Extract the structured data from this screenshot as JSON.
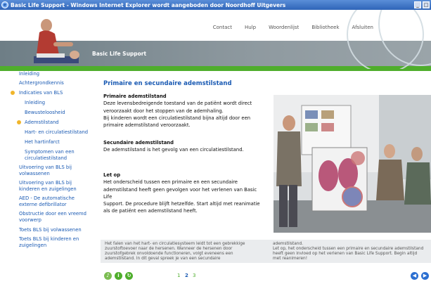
{
  "window": {
    "title": "Basic Life Support - Windows Internet Explorer wordt aangeboden door Noordhoff Uitgevers"
  },
  "topnav": [
    "Contact",
    "Hulp",
    "Woordenlijst",
    "Bibliotheek",
    "Afsluiten"
  ],
  "header": {
    "section_title": "Basic Life Support"
  },
  "sidebar": {
    "items": [
      {
        "label": "Inleiding"
      },
      {
        "label": "Achtergrondkennis"
      },
      {
        "label": "Indicaties van BLS"
      },
      {
        "label": "Inleiding"
      },
      {
        "label": "Bewusteloosheid"
      },
      {
        "label": "Ademstilstand"
      },
      {
        "label": "Hart- en circulatiestilstand"
      },
      {
        "label": "Het hartinfarct"
      },
      {
        "label": "Symptomen van een"
      },
      {
        "label": "circulatiestilstand"
      },
      {
        "label": "Uitvoering van BLS bij"
      },
      {
        "label": "volwassenen"
      },
      {
        "label": "Uitvoering van BLS bij"
      },
      {
        "label": "kinderen en zuigelingen"
      },
      {
        "label": "AED - De automatische"
      },
      {
        "label": "externe defibrillator"
      },
      {
        "label": "Obstructie door een vreemd"
      },
      {
        "label": "voorwerp"
      },
      {
        "label": "Toets BLS bij volwassenen"
      },
      {
        "label": "Toets BLS bij kinderen en"
      },
      {
        "label": "zuigelingen"
      }
    ]
  },
  "main": {
    "title": "Primaire en secundaire ademstilstand",
    "primary_heading": "Primaire ademstilstand",
    "primary_lines": [
      "Deze levensbedreigende toestand van de patiënt wordt direct",
      "veroorzaakt door het stoppen van de ademhaling.",
      "Bij kinderen wordt een circulatiestilstand bijna altijd door een",
      "primaire ademstilstand veroorzaakt."
    ],
    "secondary_heading": "Secundaire ademstilstand",
    "secondary_line": "De ademstilstand is het gevolg van een circulatiestilstand.",
    "note_heading": "Let op",
    "note_lines": [
      "Het onderscheid tussen een primaire en een secundaire",
      "ademstilstand heeft geen gevolgen voor het verlenen van Basic Life",
      "Support. De procedure blijft hetzelfde. Start altijd met reanimatie",
      "als de patiënt een ademstilstand heeft."
    ]
  },
  "caption": {
    "left_lines": [
      "Het falen van het hart- en circulatiesysteem leidt tot een gebrekkige",
      "zuurstoftoevoer naar de hersenen. Wanneer de hersenen door",
      "zuurstofgebrek onvoldoende functioneren, volgt eveneens een",
      "ademstilstand. In dit geval spreek je van een secundaire"
    ],
    "right_lines": [
      "ademstilstand.",
      "Let op, het onderscheid tussen een primaire en secundaire ademstilstand",
      "heeft geen invloed op het verlenen van Basic Life Support. Begin altijd",
      "met reanimeren!"
    ]
  },
  "footer": {
    "pages": [
      "1",
      "2",
      "3"
    ],
    "current_page": "2"
  },
  "colors": {
    "link_blue": "#1a5ab3",
    "accent_green": "#4fae2c",
    "bullet_orange": "#f0b52b",
    "nav_blue": "#2b6fd1"
  },
  "icons": {
    "footer_left": [
      "audio-icon",
      "info-icon",
      "refresh-icon"
    ],
    "footer_right": [
      "previous-icon",
      "next-icon"
    ]
  }
}
